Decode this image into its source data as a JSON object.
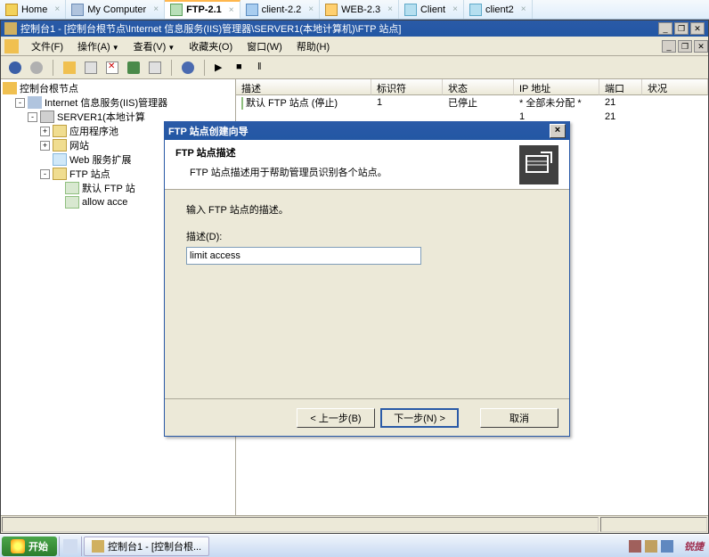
{
  "browser_tabs": [
    {
      "label": "Home",
      "icon": "i-home"
    },
    {
      "label": "My Computer",
      "icon": "i-pc"
    },
    {
      "label": "FTP-2.1",
      "icon": "i-ftp",
      "active": true
    },
    {
      "label": "client-2.2",
      "icon": "i-client"
    },
    {
      "label": "WEB-2.3",
      "icon": "i-web"
    },
    {
      "label": "Client",
      "icon": "i-client2"
    },
    {
      "label": "client2",
      "icon": "i-client2"
    }
  ],
  "window": {
    "title": "控制台1 - [控制台根节点\\Internet 信息服务(IIS)管理器\\SERVER1(本地计算机)\\FTP 站点]"
  },
  "menu": {
    "file": "文件(F)",
    "action": "操作(A)",
    "view": "查看(V)",
    "favorites": "收藏夹(O)",
    "window": "窗口(W)",
    "help": "帮助(H)"
  },
  "tree": {
    "root": "控制台根节点",
    "iis": "Internet 信息服务(IIS)管理器",
    "server": "SERVER1(本地计算",
    "apppool": "应用程序池",
    "websites": "网站",
    "webext": "Web 服务扩展",
    "ftp": "FTP 站点",
    "ftp_default": "默认 FTP 站",
    "ftp_allow": "allow acce"
  },
  "list": {
    "headers": {
      "desc": "描述",
      "id": "标识符",
      "status": "状态",
      "ip": "IP 地址",
      "port": "端口",
      "state": "状况"
    },
    "col_widths": {
      "desc": 152,
      "id": 80,
      "status": 80,
      "ip": 96,
      "port": 48,
      "state": 60
    },
    "rows": [
      {
        "desc": "默认 FTP 站点 (停止)",
        "id": "1",
        "status": "已停止",
        "ip": "* 全部未分配 *",
        "port": "21",
        "state": ""
      },
      {
        "desc": "",
        "id": "",
        "status": "",
        "ip": "1",
        "port": "21",
        "state": ""
      }
    ]
  },
  "wizard": {
    "title": "FTP 站点创建向导",
    "heading": "FTP 站点描述",
    "subheading": "FTP 站点描述用于帮助管理员识别各个站点。",
    "prompt": "输入 FTP 站点的描述。",
    "field_label": "描述(D):",
    "field_value": "limit access",
    "btn_back": "< 上一步(B)",
    "btn_next": "下一步(N) >",
    "btn_cancel": "取消"
  },
  "taskbar": {
    "start": "开始",
    "task": "控制台1 - [控制台根..."
  },
  "brand": "锐捷"
}
